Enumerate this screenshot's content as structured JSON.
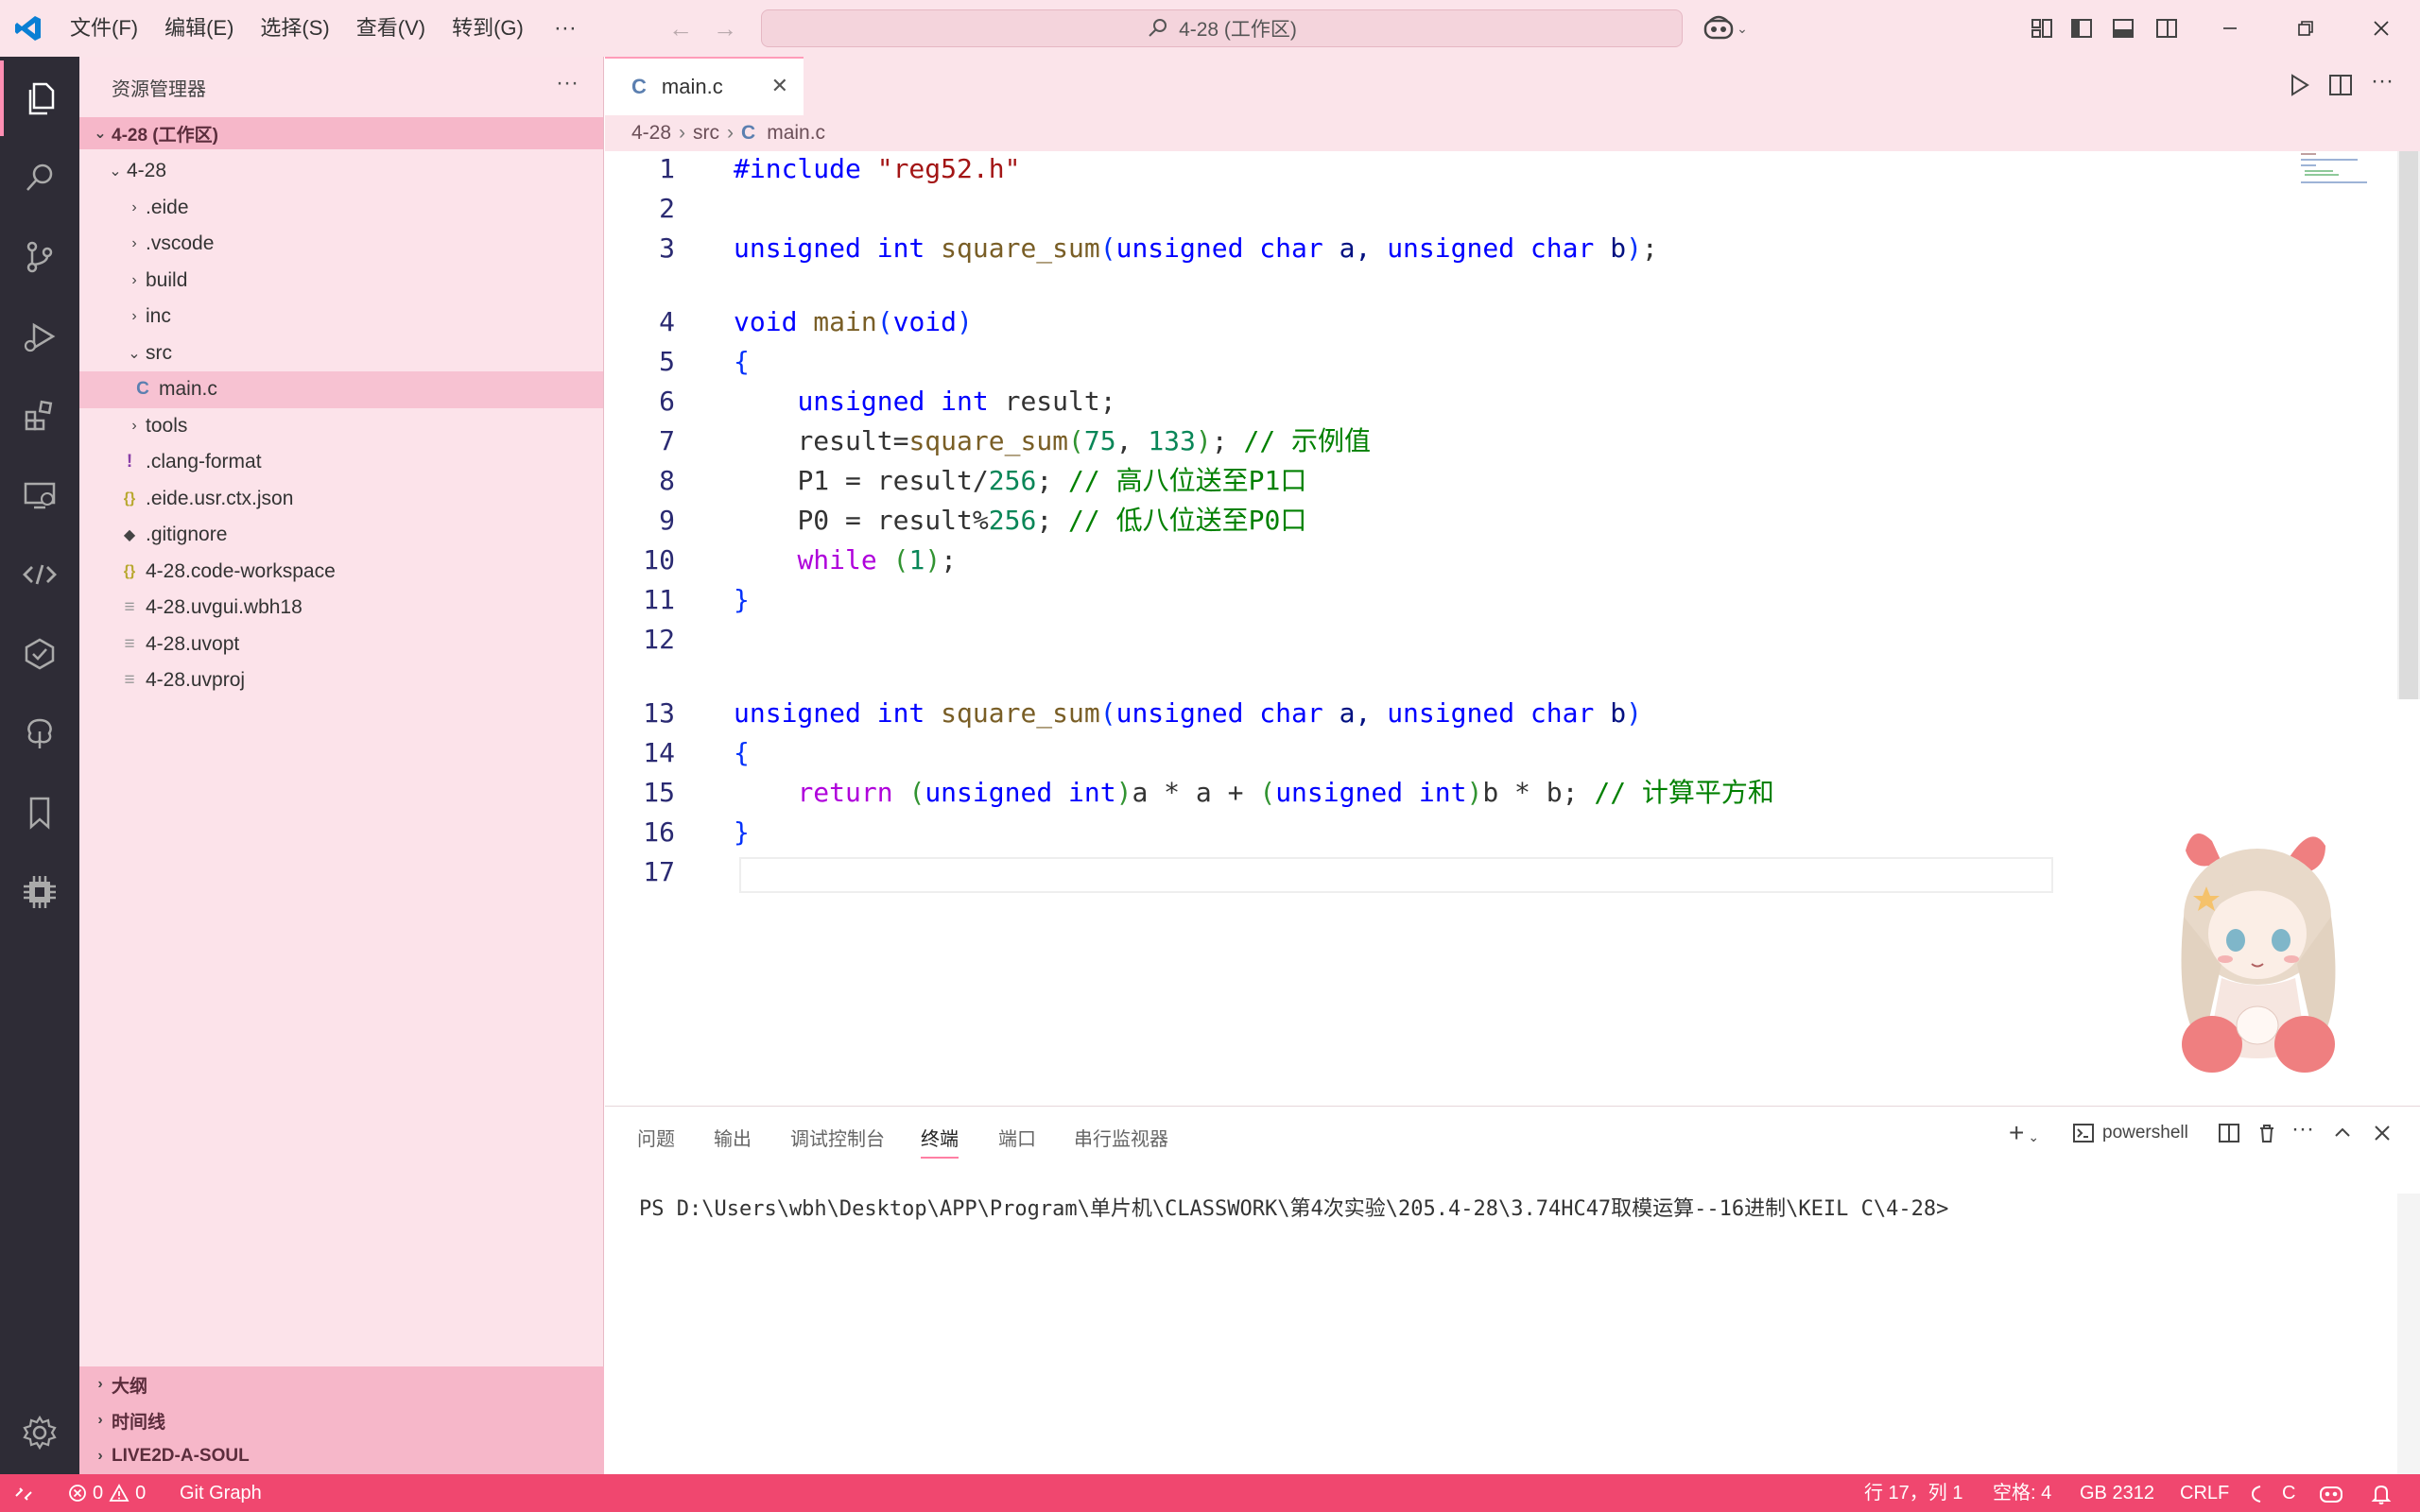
{
  "menu": {
    "file": "文件(F)",
    "edit": "编辑(E)",
    "selection": "选择(S)",
    "view": "查看(V)",
    "goto": "转到(G)",
    "more": "···"
  },
  "search": {
    "text": "4-28 (工作区)"
  },
  "sidebar": {
    "title": "资源管理器",
    "more": "···",
    "workspace": "4-28 (工作区)",
    "items": [
      {
        "label": "4-28",
        "chevron": "⌄"
      },
      {
        "label": ".eide",
        "chevron": "›"
      },
      {
        "label": ".vscode",
        "chevron": "›"
      },
      {
        "label": "build",
        "chevron": "›"
      },
      {
        "label": "inc",
        "chevron": "›"
      },
      {
        "label": "src",
        "chevron": "⌄"
      },
      {
        "label": "main.c",
        "icon": "C"
      },
      {
        "label": "tools",
        "chevron": "›"
      },
      {
        "label": ".clang-format",
        "icon": "!"
      },
      {
        "label": ".eide.usr.ctx.json",
        "icon": "{}"
      },
      {
        "label": ".gitignore",
        "icon": "◆"
      },
      {
        "label": "4-28.code-workspace",
        "icon": "{}"
      },
      {
        "label": "4-28.uvgui.wbh18",
        "icon": "≡"
      },
      {
        "label": "4-28.uvopt",
        "icon": "≡"
      },
      {
        "label": "4-28.uvproj",
        "icon": "≡"
      }
    ],
    "outline": "大纲",
    "timeline": "时间线",
    "live2d": "LIVE2D-A-SOUL"
  },
  "editor": {
    "tab_icon": "C",
    "tab_label": "main.c",
    "tab_close": "✕",
    "breadcrumb": [
      "4-28",
      "src",
      "main.c"
    ],
    "breadcrumb_icon": "C",
    "line_numbers": [
      "1",
      "2",
      "3",
      "4",
      "5",
      "6",
      "7",
      "8",
      "9",
      "10",
      "11",
      "12",
      "13",
      "14",
      "15",
      "16",
      "17"
    ],
    "code": {
      "l1_dir": "#include",
      "l1_str": " \"reg52.h\"",
      "l3_t1": "unsigned",
      "l3_t2": " int ",
      "l3_fn": "square_sum",
      "l3_po": "(",
      "l3_t3": "unsigned",
      "l3_t4": " char ",
      "l3_a": "a, ",
      "l3_t5": "unsigned",
      "l3_t6": " char ",
      "l3_b": "b",
      "l3_pc": ")",
      "l3_end": ";",
      "l4_void": "void ",
      "l4_fn": "main",
      "l4_po": "(",
      "l4_void2": "void",
      "l4_pc": ")",
      "l5": "{",
      "l6_t1": "unsigned",
      "l6_t2": " int",
      "l6_rest": " result;",
      "l7_a": "result=",
      "l7_fn": "square_sum",
      "l7_po": "(",
      "l7_n1": "75",
      "l7_c": ", ",
      "l7_n2": "133",
      "l7_pc": ")",
      "l7_semi": "; ",
      "l7_cmt": "// 示例值",
      "l8_a": "P1 = result/",
      "l8_n": "256",
      "l8_semi": "; ",
      "l8_cmt": "// 高八位送至P1口",
      "l9_a": "P0 = result%",
      "l9_n": "256",
      "l9_semi": "; ",
      "l9_cmt": "// 低八位送至P0口",
      "l10_kw": "while",
      "l10_po": " (",
      "l10_n": "1",
      "l10_pc": ")",
      "l10_end": ";",
      "l11": "}",
      "l13_t1": "unsigned",
      "l13_t2": " int ",
      "l13_fn": "square_sum",
      "l13_po": "(",
      "l13_t3": "unsigned",
      "l13_t4": " char ",
      "l13_a": "a, ",
      "l13_t5": "unsigned",
      "l13_t6": " char ",
      "l13_b": "b",
      "l13_pc": ")",
      "l14": "{",
      "l15_ret": "return",
      "l15_po1": " (",
      "l15_t1": "unsigned",
      "l15_t2": " int",
      "l15_pc1": ")",
      "l15_mid": "a * a + ",
      "l15_po2": "(",
      "l15_t3": "unsigned",
      "l15_t4": " int",
      "l15_pc2": ")",
      "l15_end": "b * b; ",
      "l15_cmt": "// 计算平方和",
      "l16": "}"
    }
  },
  "panel": {
    "tabs": [
      "问题",
      "输出",
      "调试控制台",
      "终端",
      "端口",
      "串行监视器"
    ],
    "shell": "powershell",
    "prompt": "PS D:\\Users\\wbh\\Desktop\\APP\\Program\\单片机\\CLASSWORK\\第4次实验\\205.4-28\\3.74HC47取模运算--16进制\\KEIL C\\4-28>"
  },
  "status": {
    "errors": "0",
    "warnings": "0",
    "git_graph": "Git Graph",
    "position": "行 17，列 1",
    "spaces": "空格: 4",
    "encoding": "GB 2312",
    "eol": "CRLF",
    "language": "C"
  },
  "colors": {
    "accent": "#f0476f",
    "sidebar_bg": "#fce3ea",
    "section_bg": "#f6b7c9",
    "activity_bg": "#2e2c36"
  }
}
